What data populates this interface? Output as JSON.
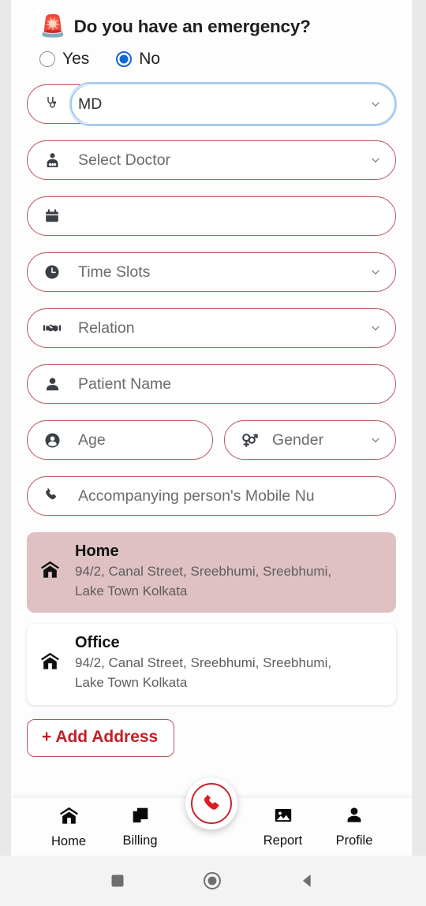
{
  "app": {
    "emergency_question": "Do you have an emergency?",
    "siren_icon": "rotating-light-icon"
  },
  "emergency_options": [
    {
      "label": "Yes",
      "selected": false
    },
    {
      "label": "No",
      "selected": true
    }
  ],
  "form": {
    "specialization": {
      "icon": "stethoscope-icon",
      "value": "MD",
      "focused": true
    },
    "doctor": {
      "icon": "doctor-icon",
      "placeholder": "Select Doctor"
    },
    "date": {
      "icon": "calendar-icon",
      "placeholder": ""
    },
    "time_slots": {
      "icon": "clock-icon",
      "placeholder": "Time Slots"
    },
    "relation": {
      "icon": "handshake-icon",
      "placeholder": "Relation"
    },
    "patient_name": {
      "icon": "person-icon",
      "placeholder": "Patient Name"
    },
    "age": {
      "icon": "account-circle-icon",
      "placeholder": "Age"
    },
    "gender": {
      "icon": "gender-icon",
      "placeholder": "Gender"
    },
    "mobile": {
      "icon": "phone-icon",
      "placeholder": "Accompanying person's Mobile Nu"
    }
  },
  "addresses": [
    {
      "icon": "home-icon",
      "title": "Home",
      "line1": "94/2, Canal Street, Sreebhumi, Sreebhumi,",
      "line2": "Lake Town Kolkata",
      "selected": true
    },
    {
      "icon": "home-icon",
      "title": "Office",
      "line1": "94/2, Canal Street, Sreebhumi, Sreebhumi,",
      "line2": "Lake Town Kolkata",
      "selected": false
    }
  ],
  "add_address_label": "+ Add Address",
  "bottom_nav": {
    "items": [
      {
        "label": "Home",
        "icon": "home-icon"
      },
      {
        "label": "Billing",
        "icon": "billing-copy-icon"
      },
      {
        "label": "Report",
        "icon": "image-report-icon"
      },
      {
        "label": "Profile",
        "icon": "person-icon"
      }
    ],
    "fab": {
      "icon": "phone-call-icon"
    }
  },
  "system_nav": {
    "recent": "square-recents-icon",
    "home": "circle-home-icon",
    "back": "triangle-back-icon"
  },
  "colors": {
    "field_border": "#b5565c",
    "accent_red": "#c31f28",
    "focus_blue": "#a8cdf0",
    "radio_blue": "#1565d8",
    "selected_card": "#dfc0c3"
  }
}
